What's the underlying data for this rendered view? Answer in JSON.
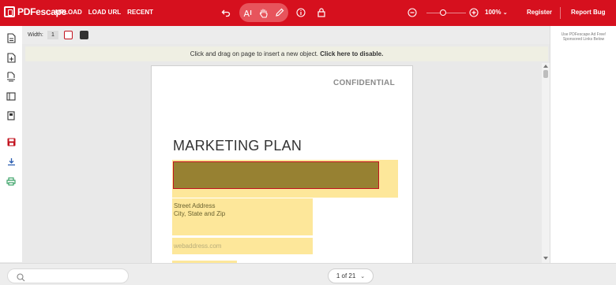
{
  "app": {
    "logo_text": "PDFescape"
  },
  "topnav": [
    "UPLOAD",
    "LOAD URL",
    "RECENT"
  ],
  "toolbar": {
    "icons": [
      "undo-icon",
      "text-tool-icon",
      "hand-tool-icon",
      "pencil-tool-icon",
      "info-icon",
      "lock-icon"
    ],
    "zoom_out": "zoom-out-icon",
    "zoom_in": "zoom-in-icon",
    "zoom_level": "100%",
    "register": "Register",
    "report_bug": "Report Bug",
    "accent_color": "#d6101e"
  },
  "sidebar": {
    "icons": [
      "page-icon",
      "add-page-icon",
      "page-flow-icon",
      "panel-icon",
      "book-icon",
      "save-icon",
      "download-icon",
      "print-icon"
    ]
  },
  "objbar": {
    "width_label": "Width:",
    "width_value": "1"
  },
  "notice": {
    "text": "Click and drag on page to insert a new object.",
    "link": "Click here to disable."
  },
  "page": {
    "confidential": "CONFIDENTIAL",
    "title": "MARKETING PLAN",
    "address_line1": "Street Address",
    "address_line2": "City, State and Zip",
    "web": "webaddress.com"
  },
  "ad": {
    "text": "Use PDFescape Ad Free! Sponsored Links Below"
  },
  "bottom": {
    "pager_text": "1 of 21"
  }
}
